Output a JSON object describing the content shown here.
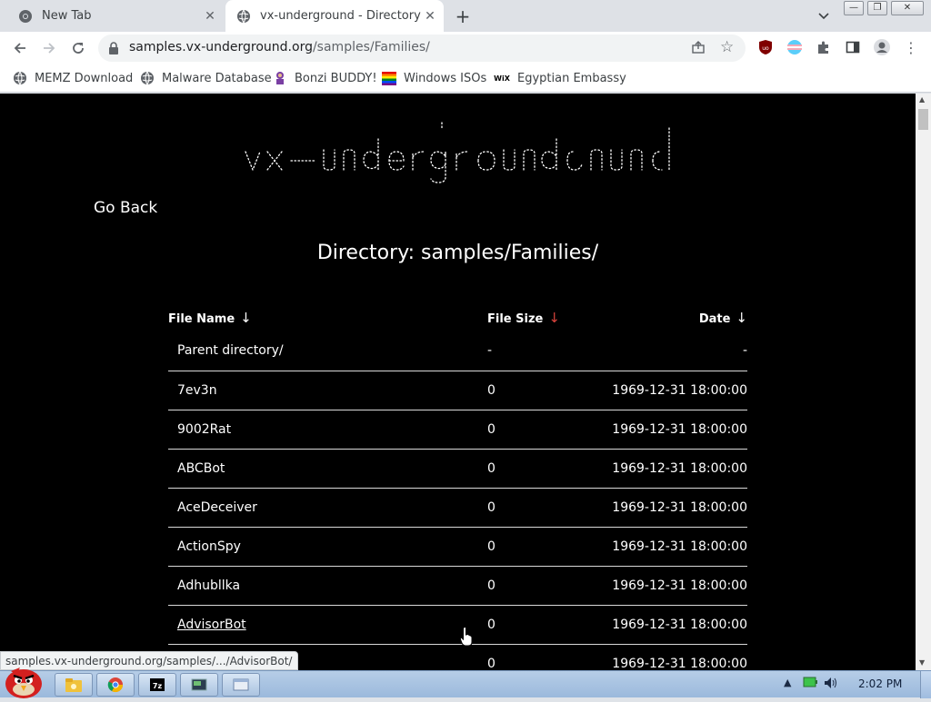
{
  "browser": {
    "tabs": [
      {
        "title": "New Tab",
        "icon": "chrome-icon",
        "active": false
      },
      {
        "title": "vx-underground - Directory",
        "icon": "globe-icon",
        "active": true
      }
    ],
    "url_host": "samples.vx-underground.org",
    "url_path": "/samples/Families/",
    "bookmarks": [
      {
        "label": "MEMZ Download",
        "icon": "globe-icon"
      },
      {
        "label": "Malware Database",
        "icon": "globe-icon"
      },
      {
        "label": "Bonzi BUDDY!",
        "icon": "bonzi-icon"
      },
      {
        "label": "Windows ISOs",
        "icon": "windows-flag-icon"
      },
      {
        "label": "Egyptian Embassy",
        "icon": "wix-icon"
      }
    ],
    "status_url": "samples.vx-underground.org/samples/.../AdvisorBot/"
  },
  "page": {
    "logo_text": "vx-underground",
    "go_back": "Go Back",
    "directory_title": "Directory: samples/Families/",
    "table": {
      "headers": {
        "name": "File Name",
        "size": "File Size",
        "date": "Date",
        "arrow": "↓"
      },
      "rows": [
        {
          "name": "Parent directory/",
          "size": "-",
          "date": "-"
        },
        {
          "name": "7ev3n",
          "size": "0",
          "date": "1969-12-31 18:00:00"
        },
        {
          "name": "9002Rat",
          "size": "0",
          "date": "1969-12-31 18:00:00"
        },
        {
          "name": "ABCBot",
          "size": "0",
          "date": "1969-12-31 18:00:00"
        },
        {
          "name": "AceDeceiver",
          "size": "0",
          "date": "1969-12-31 18:00:00"
        },
        {
          "name": "ActionSpy",
          "size": "0",
          "date": "1969-12-31 18:00:00"
        },
        {
          "name": "Adhubllka",
          "size": "0",
          "date": "1969-12-31 18:00:00"
        },
        {
          "name": "AdvisorBot",
          "size": "0",
          "date": "1969-12-31 18:00:00"
        },
        {
          "name": "",
          "size": "0",
          "date": "1969-12-31 18:00:00"
        }
      ]
    }
  },
  "taskbar": {
    "clock": "2:02 PM"
  },
  "colors": {
    "page_bg": "#000000",
    "page_text": "#ffffff",
    "sort_arrow_accent": "#d8433c",
    "ublock_red": "#800000"
  }
}
